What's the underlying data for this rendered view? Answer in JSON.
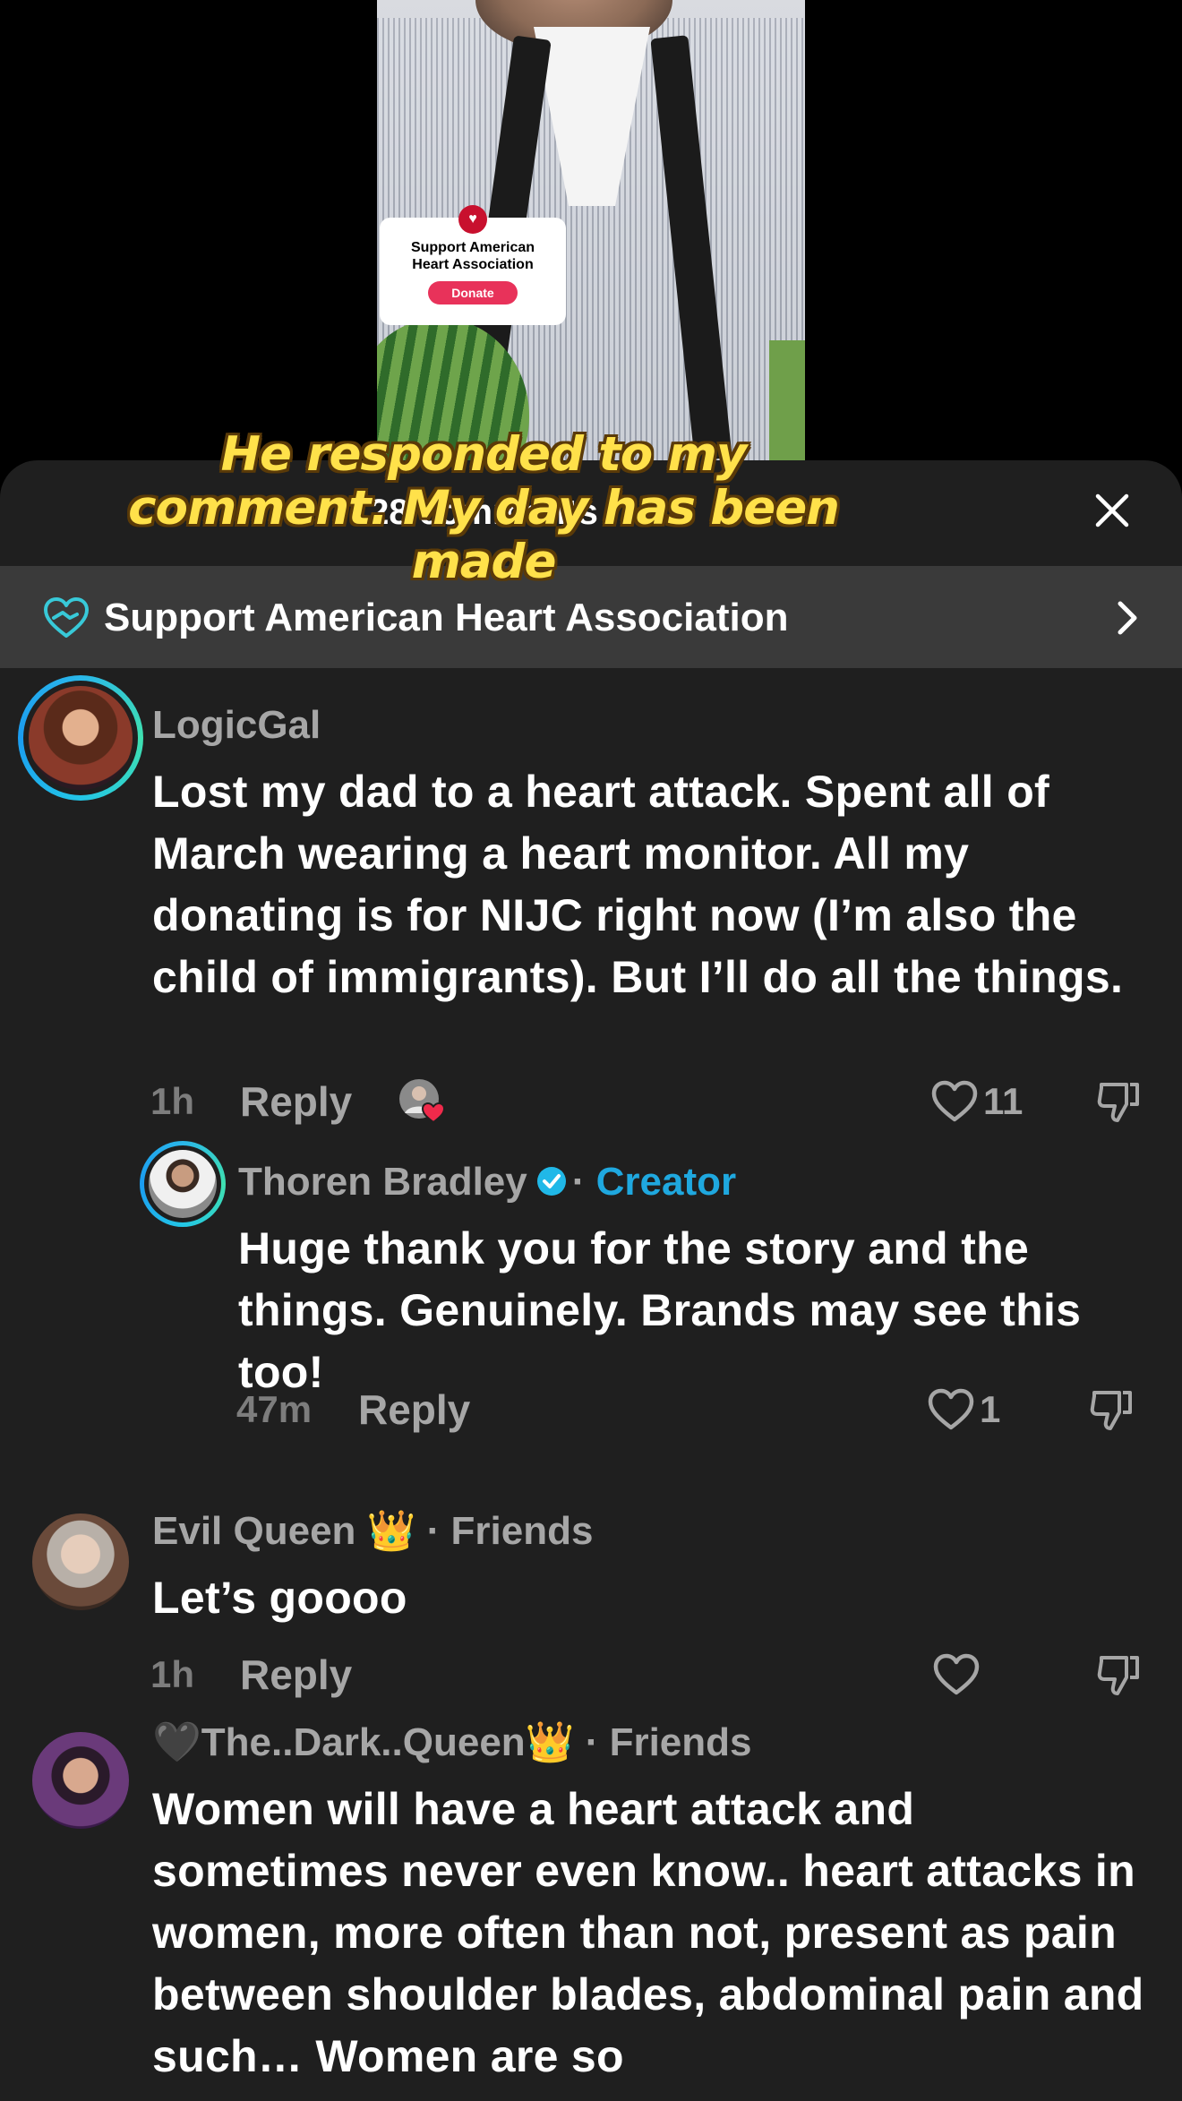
{
  "video": {
    "donate_card": {
      "title": "Support American Heart Association",
      "button": "Donate"
    }
  },
  "caption": "He responded to my comment. My day has been made",
  "sheet": {
    "title": "28 comments",
    "banner_text": "Support American Heart Association"
  },
  "comments": [
    {
      "username": "LogicGal",
      "text": "Lost my dad to a heart attack. Spent all of March wearing a heart monitor. All my donating is for NIJC right now (I’m also the child of immigrants). But I’ll do all the things.",
      "time": "1h",
      "reply": "Reply",
      "likes": "11"
    },
    {
      "username": "Thoren Bradley",
      "badge": "Creator",
      "separator": "·",
      "text": "Huge thank you for the story and the things. Genuinely. Brands may see this too!",
      "time": "47m",
      "reply": "Reply",
      "likes": "1"
    },
    {
      "username": "Evil Queen 👑",
      "badge": "Friends",
      "separator": "·",
      "text": "Let’s goooo",
      "time": "1h",
      "reply": "Reply"
    },
    {
      "username": "🖤The..Dark..Queen👑",
      "badge": "Friends",
      "separator": "·",
      "text": "Women will have a heart attack and sometimes never even know.. heart attacks in women, more often than not, present as pain between shoulder blades, abdominal pain and such… Women are so"
    }
  ],
  "colors": {
    "sheet_bg": "#1f1f1f",
    "banner_bg": "#3a3a3a",
    "creator_accent": "#1fa8df",
    "caption_fill": "#ffe14a",
    "donate_button": "#e8325a"
  },
  "icons": [
    "close-icon",
    "heart-hands-icon",
    "chevron-right-icon",
    "heart-outline-icon",
    "dislike-icon",
    "verified-badge-icon",
    "creator-liked-heart-icon"
  ]
}
